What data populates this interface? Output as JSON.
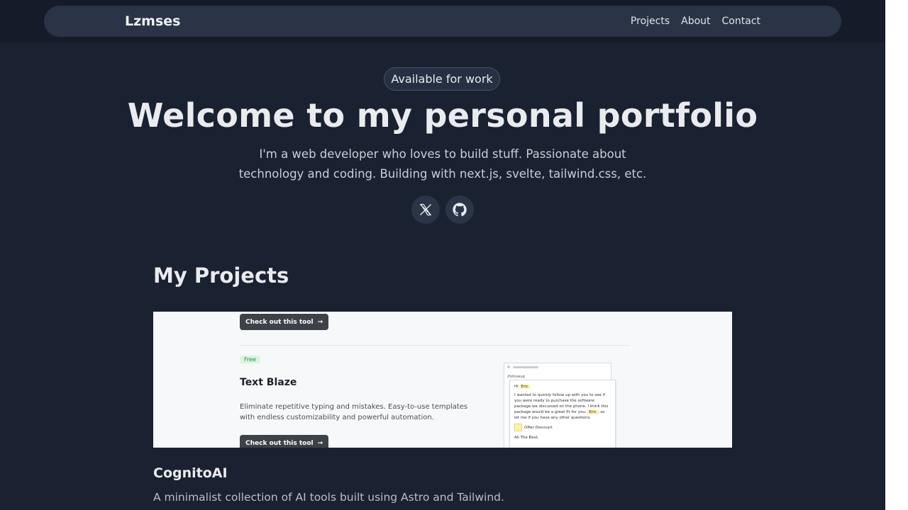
{
  "nav": {
    "brand": "Lzmses",
    "links": [
      "Projects",
      "About",
      "Contact"
    ]
  },
  "hero": {
    "badge": "Available for work",
    "title": "Welcome to my personal portfolio",
    "subtitle": "I'm a web developer who loves to build stuff. Passionate about technology and coding. Building with next.js, svelte, tailwind.css, etc.",
    "socials": [
      {
        "name": "x-icon"
      },
      {
        "name": "github-icon"
      }
    ]
  },
  "projects": {
    "section_title": "My Projects",
    "items": [
      {
        "name": "CognitoAI",
        "description": "A minimalist collection of AI tools built using Astro and Tailwind.",
        "preview": {
          "cta_label": "Check out this tool",
          "badge": "Free",
          "title": "Text Blaze",
          "description": "Eliminate repetitive typing and mistakes. Easy-to-use templates with endless customizability and powerful automation.",
          "mock": {
            "shortcut": "/followup",
            "greeting": "Hi",
            "name_field": "Eric",
            "body": "I wanted to quickly follow up with you to see if you were ready to purchase the software package we discussed on the phone. I think this package would be a great fit for you,",
            "body_end": ", so let me if you have any other questions.",
            "checkbox_label": "Offer Discount",
            "signoff": "All The Best,"
          }
        }
      }
    ]
  },
  "colors": {
    "background": "#1a2130",
    "navbar": "#2a3446",
    "text": "#e9ebef"
  }
}
